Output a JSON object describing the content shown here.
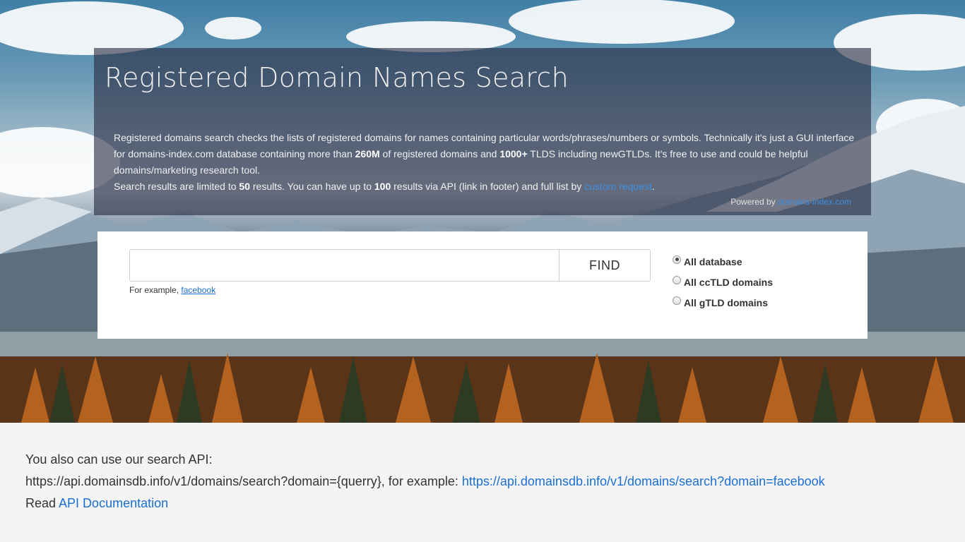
{
  "hero": {
    "title": "Registered Domain Names Search",
    "description": {
      "p1_a": "Registered domains search checks the lists of registered domains for names containing particular words/phrases/numbers or symbols. Technically it's just a GUI interface for domains-index.com database containing more than ",
      "p1_b": "260M",
      "p1_c": " of registered domains and ",
      "p1_d": "1000+",
      "p1_e": " TLDS including newGTLDs. It's free to use and could be helpful domains/marketing research tool.",
      "p2_a": "Search results are limited to ",
      "p2_b": "50",
      "p2_c": " results. You can have up to ",
      "p2_d": "100",
      "p2_e": " results via API (link in footer) and full list by ",
      "p2_link": "custom request",
      "p2_f": "."
    },
    "powered_by_label": "Powered by ",
    "powered_by_link": "domains-index.com"
  },
  "search": {
    "input_value": "",
    "placeholder": "",
    "find_label": "FIND",
    "example_label": "For example, ",
    "example_link": "facebook",
    "scope_options": [
      {
        "label": "All database",
        "checked": true
      },
      {
        "label": "All ccTLD domains",
        "checked": false
      },
      {
        "label": "All gTLD domains",
        "checked": false
      }
    ]
  },
  "api": {
    "line1": "You also can use our search API:",
    "line2_prefix": "https://api.domainsdb.info/v1/domains/search?domain={querry}, for example: ",
    "line2_link": "https://api.domainsdb.info/v1/domains/search?domain=facebook",
    "line3_prefix": "Read ",
    "line3_link": "API Documentation"
  },
  "colors": {
    "link": "#1a6fd3",
    "panel": "#282c42",
    "footer_bg": "#f4f4f4"
  }
}
